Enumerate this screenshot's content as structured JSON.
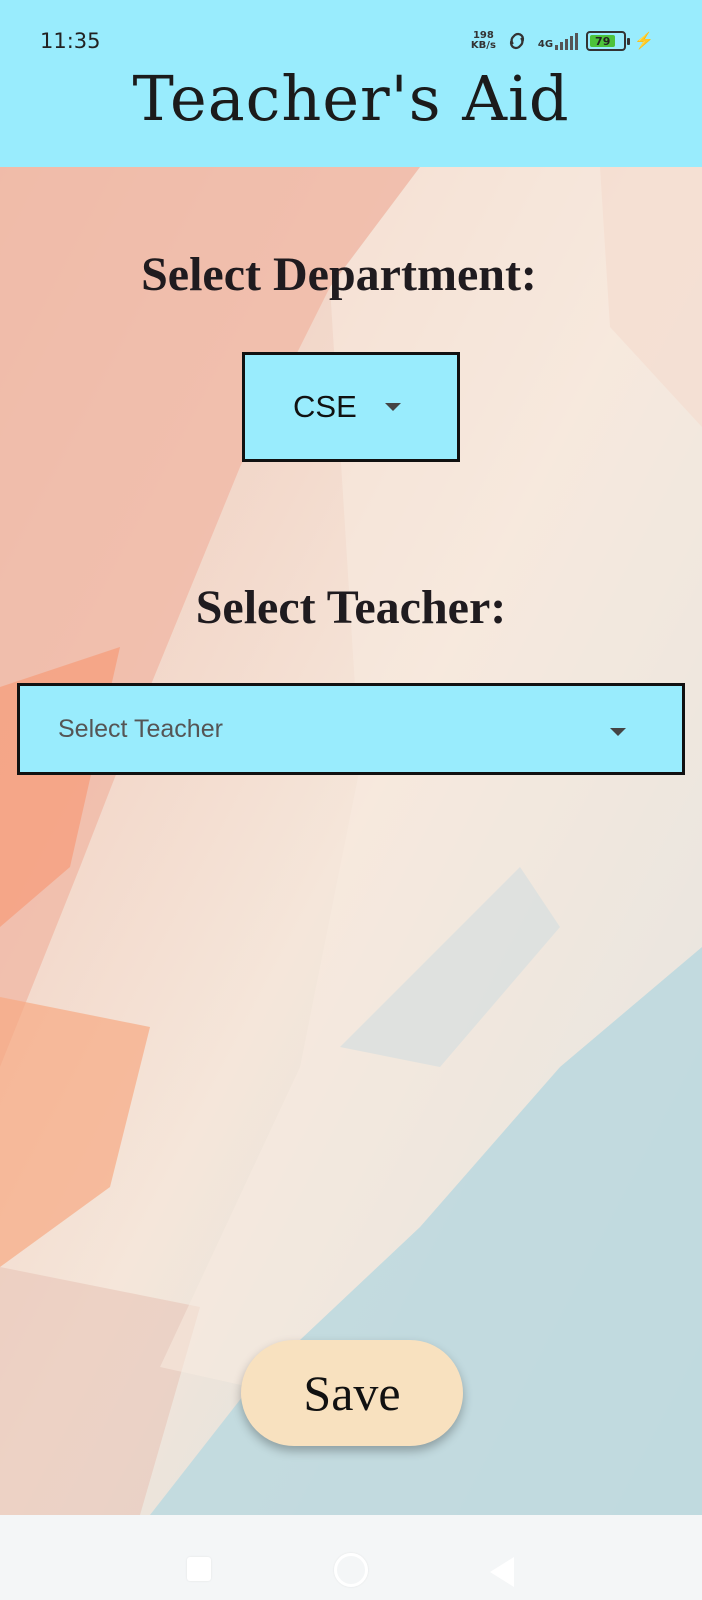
{
  "status_bar": {
    "time": "11:35",
    "net_speed_value": "198",
    "net_speed_unit": "KB/s",
    "network_type": "4G",
    "battery_level": "79"
  },
  "app": {
    "title": "Teacher's Aid"
  },
  "form": {
    "department_label": "Select Department:",
    "department_value": "CSE",
    "teacher_label": "Select Teacher:",
    "teacher_placeholder": "Select Teacher",
    "save_label": "Save"
  },
  "colors": {
    "header_bg": "#99ecfd",
    "dropdown_bg": "#99ecfd",
    "save_button_bg": "#f8e1bf"
  }
}
